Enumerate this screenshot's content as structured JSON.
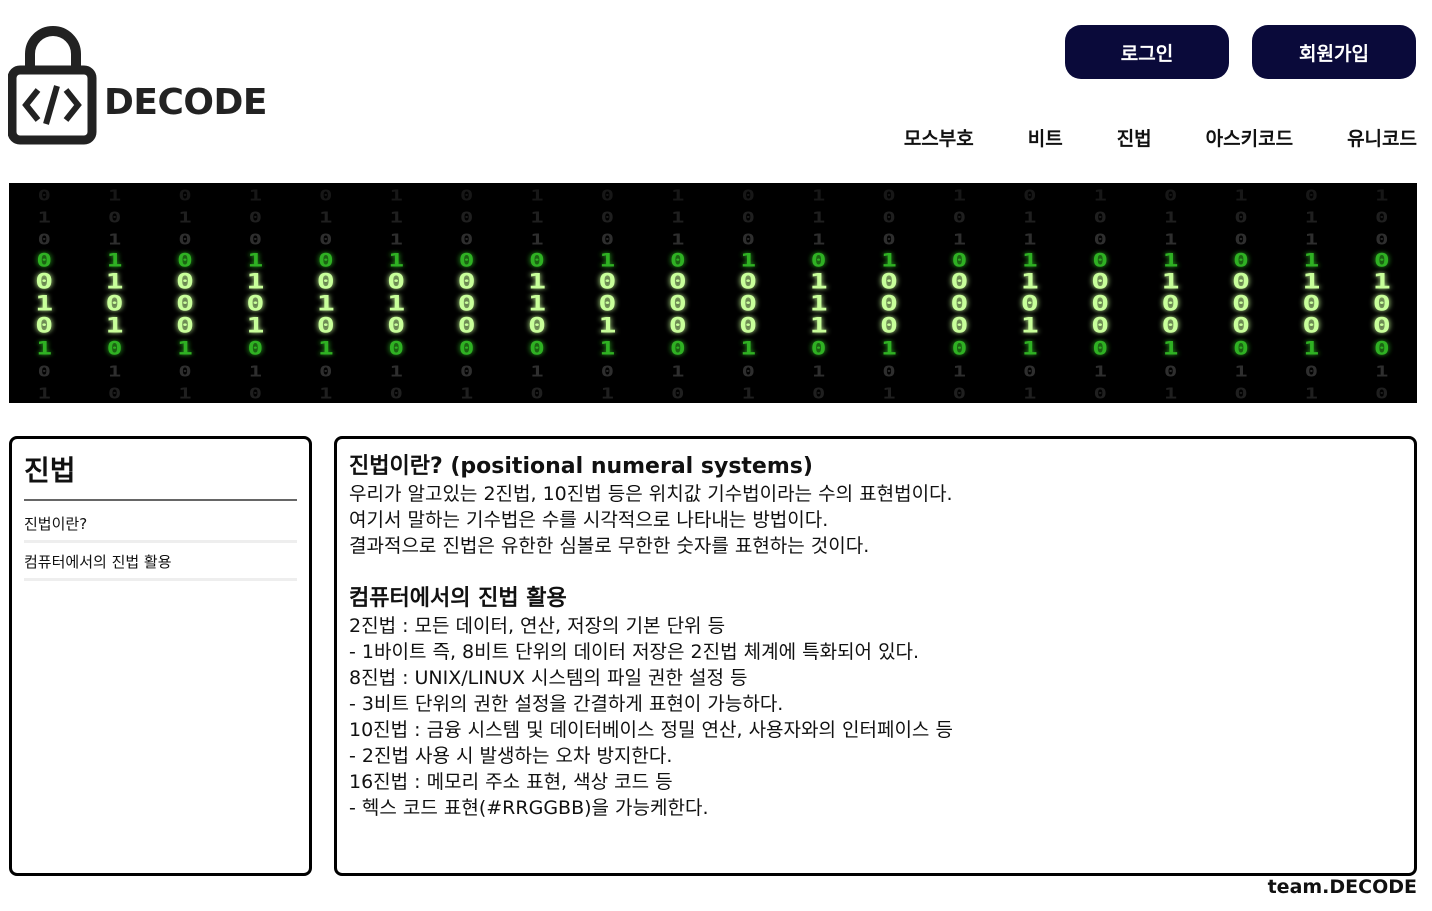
{
  "header": {
    "logo_text": "DECODE",
    "login_label": "로그인",
    "signup_label": "회원가입",
    "nav": [
      "모스부호",
      "비트",
      "진법",
      "아스키코드",
      "유니코드"
    ]
  },
  "banner": {
    "rows": [
      "01010101010101010101",
      "10101101010100101010",
      "01000101010101101010",
      "01010100101010101010",
      "01010001000100101011",
      "10001101000100000000",
      "01010000100100100000",
      "10101000101010101010",
      "01010101010101010101",
      "10101010101010101010"
    ]
  },
  "sidebar": {
    "title": "진법",
    "items": [
      "진법이란?",
      "컴퓨터에서의 진법 활용"
    ]
  },
  "content": {
    "section1": {
      "title": "진법이란? (positional numeral systems)",
      "lines": [
        "우리가 알고있는 2진법, 10진법 등은 위치값 기수법이라는 수의 표현법이다.",
        "여기서 말하는 기수법은 수를 시각적으로 나타내는 방법이다.",
        "결과적으로 진법은 유한한 심볼로 무한한 숫자를 표현하는 것이다."
      ]
    },
    "section2": {
      "title": "컴퓨터에서의 진법 활용",
      "lines": [
        "2진법 : 모든 데이터, 연산, 저장의 기본 단위 등",
        "- 1바이트 즉, 8비트 단위의 데이터 저장은 2진법 체계에 특화되어 있다.",
        "8진법 : UNIX/LINUX 시스템의 파일 권한 설정 등",
        "- 3비트 단위의 권한 설정을 간결하게 표현이 가능하다.",
        "10진법 : 금융 시스템 및 데이터베이스 정밀 연산, 사용자와의 인터페이스 등",
        "- 2진법 사용 시 발생하는 오차 방지한다.",
        "16진법 : 메모리 주소 표현, 색상 코드 등",
        "- 헥스 코드 표현(#RRGGBB)을 가능케한다."
      ]
    }
  },
  "footer": {
    "text": "team.DECODE"
  },
  "colors": {
    "button_bg": "#0a0a3a",
    "banner_green": "#39d12a"
  }
}
